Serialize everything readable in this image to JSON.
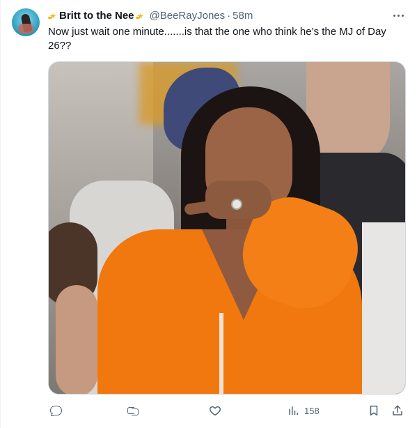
{
  "tweet": {
    "display_name": "Britt to the Nee",
    "name_emoji_left": "star-sparkle-emoji",
    "name_emoji_right": "star-sparkle-emoji",
    "handle": "@BeeRayJones",
    "separator": "·",
    "timestamp": "58m",
    "text_line_1": "Now just wait one minute.......is that the one who think he’s the MJ of Day",
    "text_line_2": "26??",
    "media": {
      "type": "photo",
      "description": "woman in orange hoodie pointing at camera"
    },
    "actions": {
      "reply_icon": "reply-icon",
      "retweet_icon": "retweet-icon",
      "like_icon": "like-icon",
      "views_icon": "views-icon",
      "views_count": "158",
      "bookmark_icon": "bookmark-icon",
      "share_icon": "share-icon"
    }
  },
  "colors": {
    "text_primary": "#0f1419",
    "text_secondary": "#536471",
    "border": "#cfd9de",
    "hoodie_orange": "#f0780e"
  }
}
